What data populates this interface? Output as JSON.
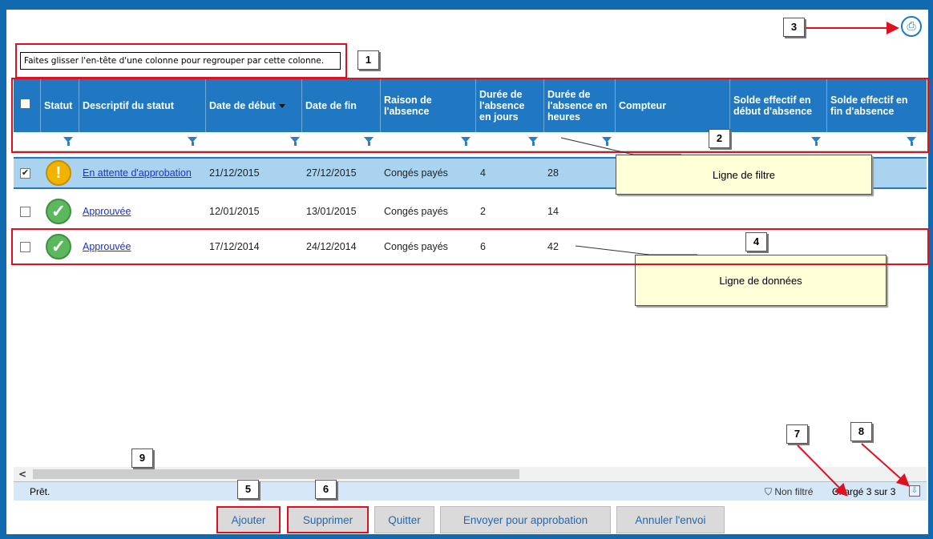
{
  "group_hint": "Faites glisser l'en-tête d'une colonne pour regrouper par cette colonne.",
  "callouts": [
    "1",
    "2",
    "3",
    "4",
    "5",
    "6",
    "7",
    "8",
    "9"
  ],
  "tooltips": {
    "filter_row": "Ligne de filtre",
    "data_row": "Ligne de données"
  },
  "columns": [
    "Statut",
    "Descriptif du statut",
    "Date de début",
    "Date de fin",
    "Raison de l'absence",
    "Durée de l'absence en jours",
    "Durée de l'absence en heures",
    "Compteur",
    "Solde effectif en début d'absence",
    "Solde effectif en fin d'absence"
  ],
  "rows": [
    {
      "checked": true,
      "status_icon": "warning-icon",
      "status": "En attente d'approbation",
      "start": "21/12/2015",
      "end": "27/12/2015",
      "reason": "Congés payés",
      "days": "4",
      "hours": "28",
      "check_mark": "✔"
    },
    {
      "checked": false,
      "status_icon": "check-circle-icon",
      "status": "Approuvée",
      "start": "12/01/2015",
      "end": "13/01/2015",
      "reason": "Congés payés",
      "days": "2",
      "hours": "14",
      "check_mark": ""
    },
    {
      "checked": false,
      "status_icon": "check-circle-icon",
      "status": "Approuvée",
      "start": "17/12/2014",
      "end": "24/12/2014",
      "reason": "Congés payés",
      "days": "6",
      "hours": "42",
      "check_mark": ""
    }
  ],
  "status_bar": {
    "ready": "Prêt.",
    "filter": "Non filtré",
    "loaded": "Chargé 3 sur 3"
  },
  "buttons": {
    "add": "Ajouter",
    "delete": "Supprimer",
    "quit": "Quitter",
    "send": "Envoyer pour approbation",
    "cancel": "Annuler l'envoi"
  },
  "colors": {
    "header_bg": "#1f78c1",
    "selected_row": "#a9d3ef",
    "callout_red": "#e01020"
  }
}
